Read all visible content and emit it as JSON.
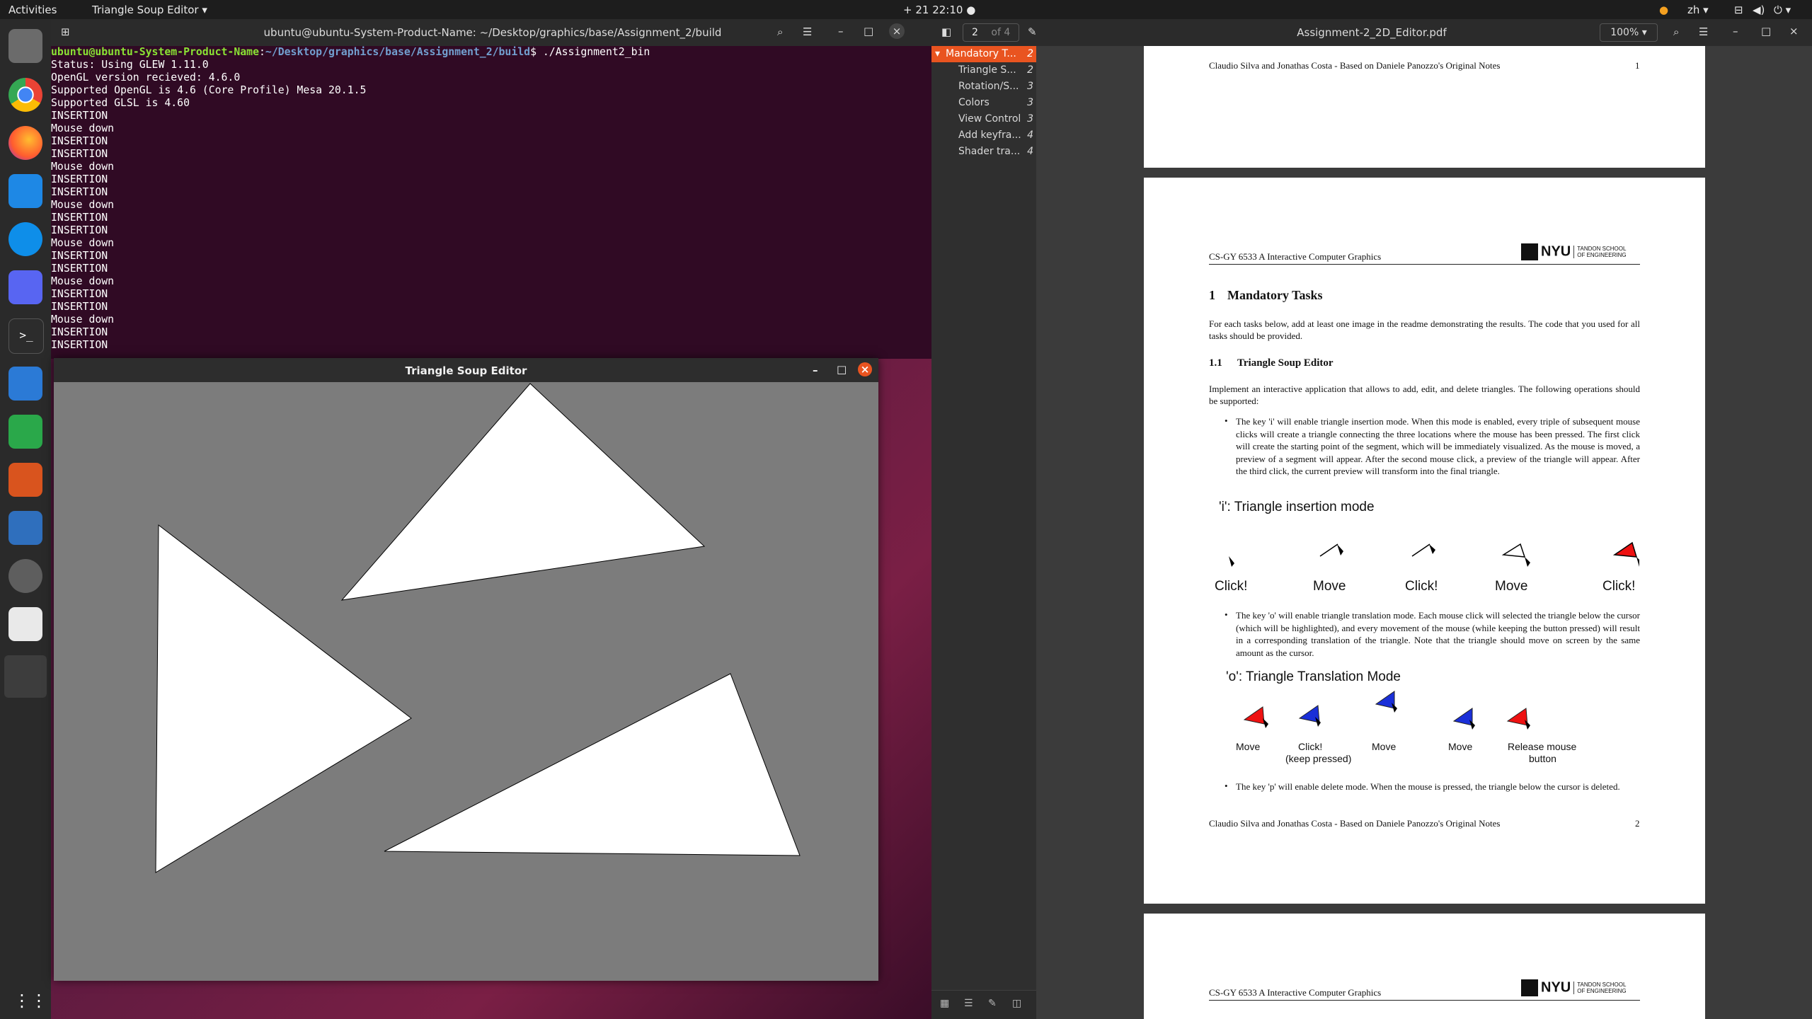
{
  "topbar": {
    "activities": "Activities",
    "app_menu": "Triangle Soup Editor",
    "clock": "21 22:10",
    "lang": "zh"
  },
  "terminal": {
    "title": "ubuntu@ubuntu-System-Product-Name: ~/Desktop/graphics/base/Assignment_2/build",
    "prompt_user": "ubuntu@ubuntu-System-Product-Name",
    "prompt_path": "~/Desktop/graphics/base/Assignment_2/build",
    "command": "$ ./Assignment2_bin",
    "lines": [
      "Status: Using GLEW 1.11.0",
      "OpenGL version recieved: 4.6.0",
      "Supported OpenGL is 4.6 (Core Profile) Mesa 20.1.5",
      "Supported GLSL is 4.60",
      "INSERTION",
      "Mouse down",
      "INSERTION",
      "INSERTION",
      "Mouse down",
      "INSERTION",
      "INSERTION",
      "Mouse down",
      "INSERTION",
      "INSERTION",
      "Mouse down",
      "INSERTION",
      "INSERTION",
      "Mouse down",
      "INSERTION",
      "INSERTION",
      "Mouse down",
      "INSERTION",
      "INSERTION"
    ]
  },
  "app": {
    "title": "Triangle Soup Editor"
  },
  "pdf": {
    "title": "Assignment-2_2D_Editor.pdf",
    "page_current": "2",
    "page_total": "of 4",
    "zoom": "100%",
    "outline": [
      {
        "label": "Mandatory T...",
        "page": "2"
      },
      {
        "label": "Triangle S...",
        "page": "2"
      },
      {
        "label": "Rotation/S...",
        "page": "3"
      },
      {
        "label": "Colors",
        "page": "3"
      },
      {
        "label": "View Control",
        "page": "3"
      },
      {
        "label": "Add keyfra...",
        "page": "4"
      },
      {
        "label": "Shader tra...",
        "page": "4"
      }
    ],
    "footer_left": "Claudio Silva and Jonathas Costa - Based on Daniele Panozzo's Original Notes",
    "page1_num": "1",
    "page2_num": "2",
    "header_course": "CS-GY 6533 A  Interactive Computer Graphics",
    "logo_text": "NYU",
    "logo_school": "TANDON SCHOOL OF ENGINEERING",
    "section_num": "1",
    "section_title": "Mandatory Tasks",
    "intro": "For each tasks below, add at least one image in the readme demonstrating the results. The code that you used for all tasks should be provided.",
    "sub_num": "1.1",
    "sub_title": "Triangle Soup Editor",
    "sub_intro": "Implement an interactive application that allows to add, edit, and delete triangles. The following operations should be supported:",
    "bullet1": "The key 'i' will enable triangle insertion mode. When this mode is enabled, every triple of subsequent mouse clicks will create a triangle connecting the three locations where the mouse has been pressed. The first click will create the starting point of the segment, which will be immediately visualized. As the mouse is moved, a preview of a segment will appear. After the second mouse click, a preview of the triangle will appear. After the third click, the current preview will transform into the final triangle.",
    "fig1_title": "'i': Triangle insertion mode",
    "fig1_labels": [
      "Click!",
      "Move",
      "Click!",
      "Move",
      "Click!"
    ],
    "bullet2": "The key 'o' will enable triangle translation mode. Each mouse click will selected the triangle below the cursor (which will be highlighted), and every movement of the mouse (while keeping the button pressed) will result in a corresponding translation of the triangle. Note that the triangle should move on screen by the same amount as the cursor.",
    "fig2_title": "'o': Triangle Translation Mode",
    "fig2_labels": [
      "Move",
      "Click!",
      "(keep pressed)",
      "Move",
      "Move",
      "Release mouse",
      "button"
    ],
    "bullet3": "The key 'p' will enable delete mode. When the mouse is pressed, the triangle below the cursor is deleted."
  }
}
